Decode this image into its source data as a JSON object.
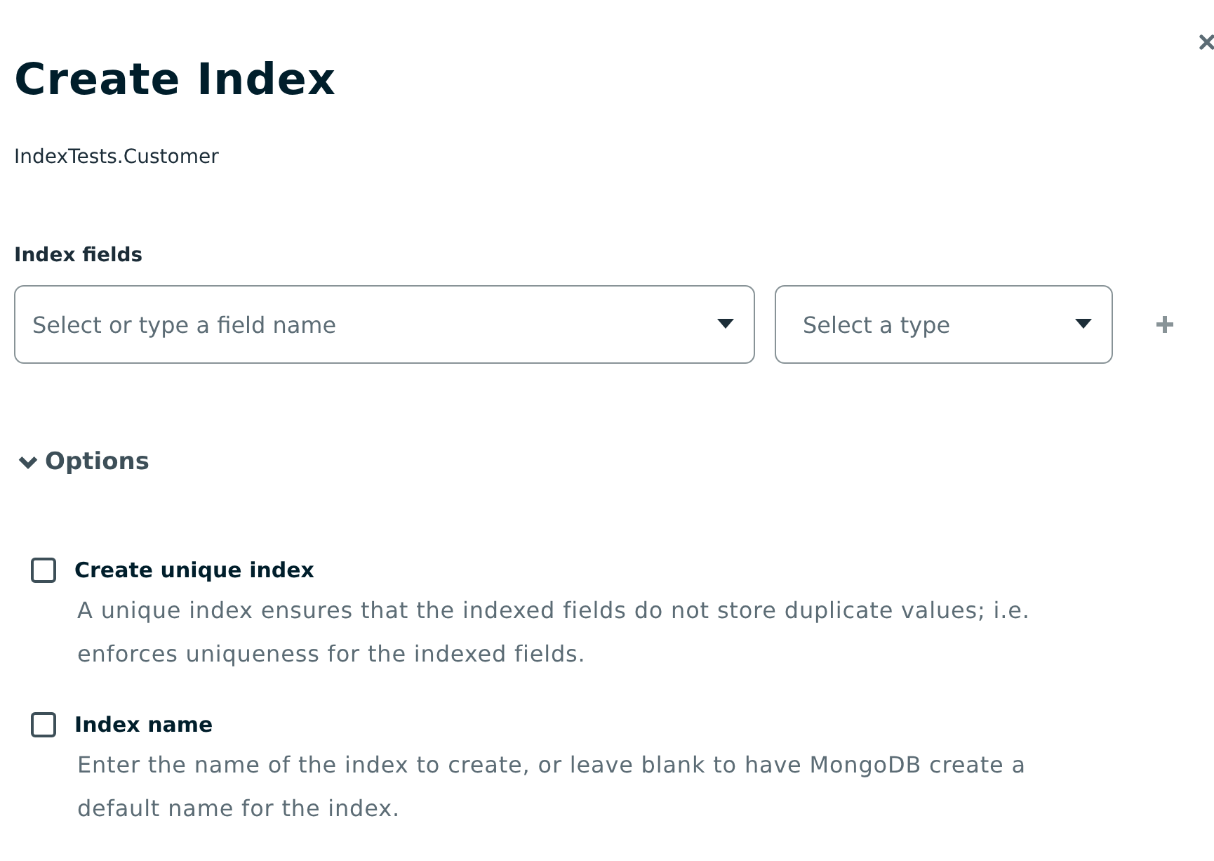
{
  "dialog": {
    "title": "Create Index",
    "namespace": "IndexTests.Customer"
  },
  "index_fields": {
    "label": "Index fields",
    "field_select": {
      "placeholder": "Select or type a field name"
    },
    "type_select": {
      "placeholder": "Select a type"
    }
  },
  "options": {
    "label": "Options",
    "expanded": true,
    "items": [
      {
        "label": "Create unique index",
        "checked": false,
        "description": "A unique index ensures that the indexed fields do not store duplicate values; i.e. enforces uniqueness for the indexed fields."
      },
      {
        "label": "Index name",
        "checked": false,
        "description": "Enter the name of the index to create, or leave blank to have MongoDB create a default name for the index."
      }
    ]
  }
}
